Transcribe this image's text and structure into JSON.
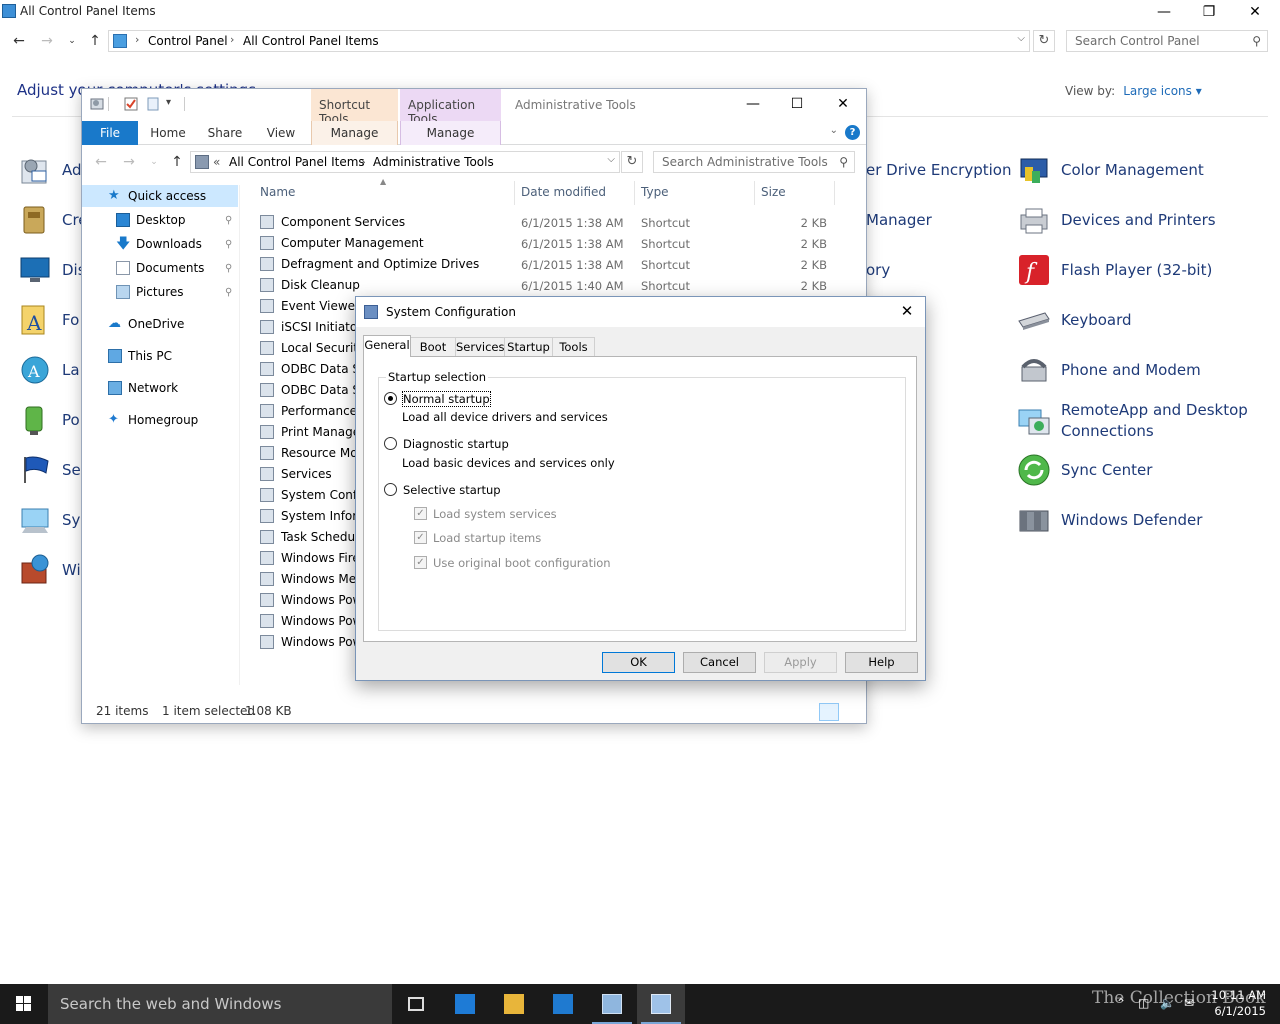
{
  "control_panel": {
    "window_title": "All Control Panel Items",
    "breadcrumb": [
      "Control Panel",
      "All Control Panel Items"
    ],
    "search_placeholder": "Search Control Panel",
    "heading": "Adjust your computer's settings",
    "view_by_label": "View by:",
    "view_by_value": "Large icons",
    "left_items": [
      "Ad",
      "Cre",
      "Dis",
      "Fo",
      "La",
      "Po",
      "Sec",
      "Sys",
      "Wi"
    ],
    "middle_items": [
      "er Drive Encryption",
      "Manager",
      "ory"
    ],
    "right_items": [
      "Color Management",
      "Devices and Printers",
      "Flash Player (32-bit)",
      "Keyboard",
      "Phone and Modem",
      "RemoteApp and Desktop Connections",
      "Sync Center",
      "Windows Defender"
    ]
  },
  "explorer": {
    "title": "Administrative Tools",
    "context_tabs": [
      "Shortcut Tools",
      "Application Tools"
    ],
    "ribbon_tabs": [
      "File",
      "Home",
      "Share",
      "View",
      "Manage",
      "Manage"
    ],
    "breadcrumb_prefix": "«",
    "breadcrumb": [
      "All Control Panel Items",
      "Administrative Tools"
    ],
    "search_placeholder": "Search Administrative Tools",
    "nav_items": [
      {
        "label": "Quick access",
        "pinned": false
      },
      {
        "label": "Desktop",
        "pinned": true
      },
      {
        "label": "Downloads",
        "pinned": true
      },
      {
        "label": "Documents",
        "pinned": true
      },
      {
        "label": "Pictures",
        "pinned": true
      },
      {
        "label": "OneDrive",
        "pinned": false
      },
      {
        "label": "This PC",
        "pinned": false
      },
      {
        "label": "Network",
        "pinned": false
      },
      {
        "label": "Homegroup",
        "pinned": false
      }
    ],
    "columns": [
      "Name",
      "Date modified",
      "Type",
      "Size"
    ],
    "rows": [
      {
        "name": "Component Services",
        "date": "6/1/2015 1:38 AM",
        "type": "Shortcut",
        "size": "2 KB"
      },
      {
        "name": "Computer Management",
        "date": "6/1/2015 1:38 AM",
        "type": "Shortcut",
        "size": "2 KB"
      },
      {
        "name": "Defragment and Optimize Drives",
        "date": "6/1/2015 1:38 AM",
        "type": "Shortcut",
        "size": "2 KB"
      },
      {
        "name": "Disk Cleanup",
        "date": "6/1/2015 1:40 AM",
        "type": "Shortcut",
        "size": "2 KB"
      },
      {
        "name": "Event Viewer",
        "date": "",
        "type": "",
        "size": ""
      },
      {
        "name": "iSCSI Initiator",
        "date": "",
        "type": "",
        "size": ""
      },
      {
        "name": "Local Security",
        "date": "",
        "type": "",
        "size": ""
      },
      {
        "name": "ODBC Data So",
        "date": "",
        "type": "",
        "size": ""
      },
      {
        "name": "ODBC Data So",
        "date": "",
        "type": "",
        "size": ""
      },
      {
        "name": "Performance M",
        "date": "",
        "type": "",
        "size": ""
      },
      {
        "name": "Print Manager",
        "date": "",
        "type": "",
        "size": ""
      },
      {
        "name": "Resource Mon",
        "date": "",
        "type": "",
        "size": ""
      },
      {
        "name": "Services",
        "date": "",
        "type": "",
        "size": ""
      },
      {
        "name": "System Config",
        "date": "",
        "type": "",
        "size": ""
      },
      {
        "name": "System Inform",
        "date": "",
        "type": "",
        "size": ""
      },
      {
        "name": "Task Schedule",
        "date": "",
        "type": "",
        "size": ""
      },
      {
        "name": "Windows Firev",
        "date": "",
        "type": "",
        "size": ""
      },
      {
        "name": "Windows Men",
        "date": "",
        "type": "",
        "size": ""
      },
      {
        "name": "Windows Pow",
        "date": "",
        "type": "",
        "size": ""
      },
      {
        "name": "Windows Pow",
        "date": "",
        "type": "",
        "size": ""
      },
      {
        "name": "Windows Pow",
        "date": "",
        "type": "",
        "size": ""
      }
    ],
    "status_count": "21 items",
    "status_selected": "1 item selected",
    "status_size": "1.08 KB"
  },
  "dialog": {
    "title": "System Configuration",
    "tabs": [
      "General",
      "Boot",
      "Services",
      "Startup",
      "Tools"
    ],
    "group_label": "Startup selection",
    "normal_label": "Normal startup",
    "normal_desc": "Load all device drivers and services",
    "diagnostic_label": "Diagnostic startup",
    "diagnostic_desc": "Load basic devices and services only",
    "selective_label": "Selective startup",
    "selected_option": "Normal startup",
    "checkboxes": [
      {
        "label": "Load system services",
        "checked": true
      },
      {
        "label": "Load startup items",
        "checked": true
      },
      {
        "label": "Use original boot configuration",
        "checked": true
      }
    ],
    "buttons": [
      "OK",
      "Cancel",
      "Apply",
      "Help"
    ]
  },
  "taskbar": {
    "search_placeholder": "Search the web and Windows",
    "watermark": "The Collection Book",
    "time": "10:11 AM",
    "date": "6/1/2015"
  },
  "colors": {
    "link_blue": "#1e3a78",
    "accent": "#1979ca",
    "taskbar": "#1a1a1a"
  }
}
